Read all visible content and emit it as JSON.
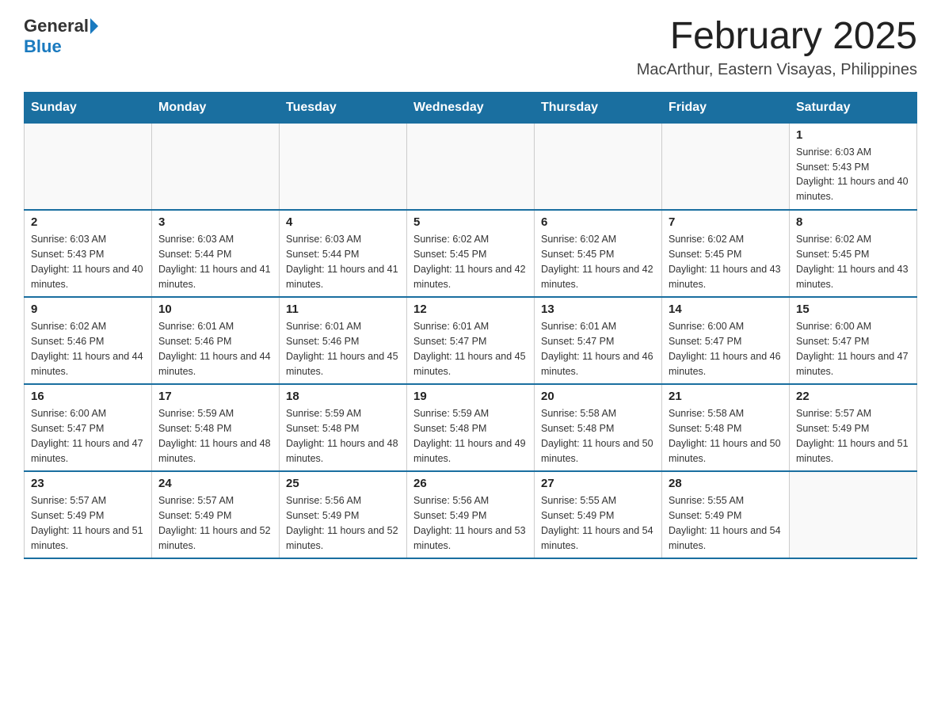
{
  "logo": {
    "general": "General",
    "blue": "Blue"
  },
  "header": {
    "title": "February 2025",
    "subtitle": "MacArthur, Eastern Visayas, Philippines"
  },
  "days_of_week": [
    "Sunday",
    "Monday",
    "Tuesday",
    "Wednesday",
    "Thursday",
    "Friday",
    "Saturday"
  ],
  "weeks": [
    [
      {
        "day": "",
        "sunrise": "",
        "sunset": "",
        "daylight": ""
      },
      {
        "day": "",
        "sunrise": "",
        "sunset": "",
        "daylight": ""
      },
      {
        "day": "",
        "sunrise": "",
        "sunset": "",
        "daylight": ""
      },
      {
        "day": "",
        "sunrise": "",
        "sunset": "",
        "daylight": ""
      },
      {
        "day": "",
        "sunrise": "",
        "sunset": "",
        "daylight": ""
      },
      {
        "day": "",
        "sunrise": "",
        "sunset": "",
        "daylight": ""
      },
      {
        "day": "1",
        "sunrise": "Sunrise: 6:03 AM",
        "sunset": "Sunset: 5:43 PM",
        "daylight": "Daylight: 11 hours and 40 minutes."
      }
    ],
    [
      {
        "day": "2",
        "sunrise": "Sunrise: 6:03 AM",
        "sunset": "Sunset: 5:43 PM",
        "daylight": "Daylight: 11 hours and 40 minutes."
      },
      {
        "day": "3",
        "sunrise": "Sunrise: 6:03 AM",
        "sunset": "Sunset: 5:44 PM",
        "daylight": "Daylight: 11 hours and 41 minutes."
      },
      {
        "day": "4",
        "sunrise": "Sunrise: 6:03 AM",
        "sunset": "Sunset: 5:44 PM",
        "daylight": "Daylight: 11 hours and 41 minutes."
      },
      {
        "day": "5",
        "sunrise": "Sunrise: 6:02 AM",
        "sunset": "Sunset: 5:45 PM",
        "daylight": "Daylight: 11 hours and 42 minutes."
      },
      {
        "day": "6",
        "sunrise": "Sunrise: 6:02 AM",
        "sunset": "Sunset: 5:45 PM",
        "daylight": "Daylight: 11 hours and 42 minutes."
      },
      {
        "day": "7",
        "sunrise": "Sunrise: 6:02 AM",
        "sunset": "Sunset: 5:45 PM",
        "daylight": "Daylight: 11 hours and 43 minutes."
      },
      {
        "day": "8",
        "sunrise": "Sunrise: 6:02 AM",
        "sunset": "Sunset: 5:45 PM",
        "daylight": "Daylight: 11 hours and 43 minutes."
      }
    ],
    [
      {
        "day": "9",
        "sunrise": "Sunrise: 6:02 AM",
        "sunset": "Sunset: 5:46 PM",
        "daylight": "Daylight: 11 hours and 44 minutes."
      },
      {
        "day": "10",
        "sunrise": "Sunrise: 6:01 AM",
        "sunset": "Sunset: 5:46 PM",
        "daylight": "Daylight: 11 hours and 44 minutes."
      },
      {
        "day": "11",
        "sunrise": "Sunrise: 6:01 AM",
        "sunset": "Sunset: 5:46 PM",
        "daylight": "Daylight: 11 hours and 45 minutes."
      },
      {
        "day": "12",
        "sunrise": "Sunrise: 6:01 AM",
        "sunset": "Sunset: 5:47 PM",
        "daylight": "Daylight: 11 hours and 45 minutes."
      },
      {
        "day": "13",
        "sunrise": "Sunrise: 6:01 AM",
        "sunset": "Sunset: 5:47 PM",
        "daylight": "Daylight: 11 hours and 46 minutes."
      },
      {
        "day": "14",
        "sunrise": "Sunrise: 6:00 AM",
        "sunset": "Sunset: 5:47 PM",
        "daylight": "Daylight: 11 hours and 46 minutes."
      },
      {
        "day": "15",
        "sunrise": "Sunrise: 6:00 AM",
        "sunset": "Sunset: 5:47 PM",
        "daylight": "Daylight: 11 hours and 47 minutes."
      }
    ],
    [
      {
        "day": "16",
        "sunrise": "Sunrise: 6:00 AM",
        "sunset": "Sunset: 5:47 PM",
        "daylight": "Daylight: 11 hours and 47 minutes."
      },
      {
        "day": "17",
        "sunrise": "Sunrise: 5:59 AM",
        "sunset": "Sunset: 5:48 PM",
        "daylight": "Daylight: 11 hours and 48 minutes."
      },
      {
        "day": "18",
        "sunrise": "Sunrise: 5:59 AM",
        "sunset": "Sunset: 5:48 PM",
        "daylight": "Daylight: 11 hours and 48 minutes."
      },
      {
        "day": "19",
        "sunrise": "Sunrise: 5:59 AM",
        "sunset": "Sunset: 5:48 PM",
        "daylight": "Daylight: 11 hours and 49 minutes."
      },
      {
        "day": "20",
        "sunrise": "Sunrise: 5:58 AM",
        "sunset": "Sunset: 5:48 PM",
        "daylight": "Daylight: 11 hours and 50 minutes."
      },
      {
        "day": "21",
        "sunrise": "Sunrise: 5:58 AM",
        "sunset": "Sunset: 5:48 PM",
        "daylight": "Daylight: 11 hours and 50 minutes."
      },
      {
        "day": "22",
        "sunrise": "Sunrise: 5:57 AM",
        "sunset": "Sunset: 5:49 PM",
        "daylight": "Daylight: 11 hours and 51 minutes."
      }
    ],
    [
      {
        "day": "23",
        "sunrise": "Sunrise: 5:57 AM",
        "sunset": "Sunset: 5:49 PM",
        "daylight": "Daylight: 11 hours and 51 minutes."
      },
      {
        "day": "24",
        "sunrise": "Sunrise: 5:57 AM",
        "sunset": "Sunset: 5:49 PM",
        "daylight": "Daylight: 11 hours and 52 minutes."
      },
      {
        "day": "25",
        "sunrise": "Sunrise: 5:56 AM",
        "sunset": "Sunset: 5:49 PM",
        "daylight": "Daylight: 11 hours and 52 minutes."
      },
      {
        "day": "26",
        "sunrise": "Sunrise: 5:56 AM",
        "sunset": "Sunset: 5:49 PM",
        "daylight": "Daylight: 11 hours and 53 minutes."
      },
      {
        "day": "27",
        "sunrise": "Sunrise: 5:55 AM",
        "sunset": "Sunset: 5:49 PM",
        "daylight": "Daylight: 11 hours and 54 minutes."
      },
      {
        "day": "28",
        "sunrise": "Sunrise: 5:55 AM",
        "sunset": "Sunset: 5:49 PM",
        "daylight": "Daylight: 11 hours and 54 minutes."
      },
      {
        "day": "",
        "sunrise": "",
        "sunset": "",
        "daylight": ""
      }
    ]
  ]
}
